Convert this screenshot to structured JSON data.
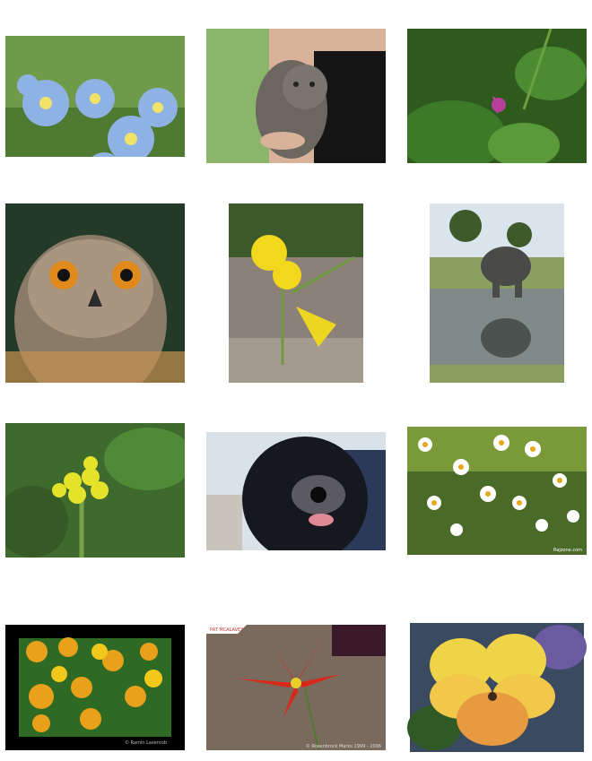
{
  "gallery": {
    "images": [
      {
        "subject": "blue forget-me-not flowers"
      },
      {
        "subject": "woman holding a gray kitten"
      },
      {
        "subject": "small pink flower among green leaves"
      },
      {
        "subject": "eagle owl with orange eyes"
      },
      {
        "subject": "yellow flowers on stone background"
      },
      {
        "subject": "elephant drinking at a waterhole"
      },
      {
        "subject": "yellow mustard flower cluster"
      },
      {
        "subject": "black dog with tongue out"
      },
      {
        "subject": "white daisy field"
      },
      {
        "subject": "orange marigolds in black frame"
      },
      {
        "subject": "red star-shaped flower"
      },
      {
        "subject": "yellow pansy in white frame"
      }
    ],
    "corner_label": "PAT MCALAVEY",
    "credit_marigold": "© Ramin Lasenrob",
    "credit_daisy": "Rajzone.com",
    "credit_red": "© Rosenbrock Marks 1999 - 2006"
  },
  "colors": {
    "background": "#ffffff",
    "frame_black": "#000000",
    "foliage": "#4f8a2e",
    "flower_yellow": "#f2d81c"
  }
}
